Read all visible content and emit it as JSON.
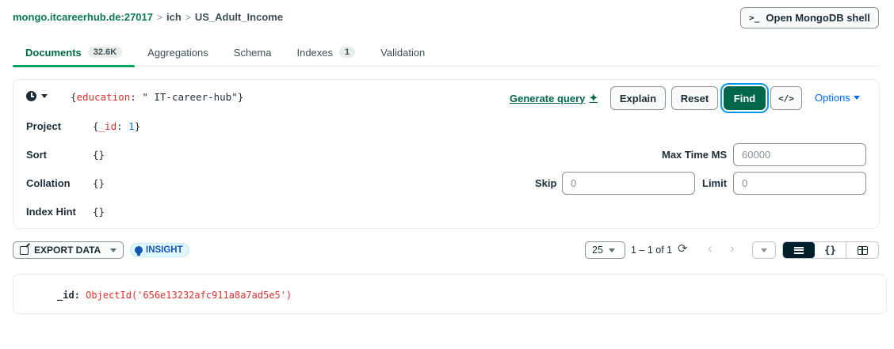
{
  "breadcrumb": {
    "host": "mongo.itcareerhub.de:27017",
    "database": "ich",
    "collection": "US_Adult_Income",
    "separator": ">"
  },
  "header": {
    "shell_button_prompt": ">_",
    "shell_button_label": "Open MongoDB shell"
  },
  "tabs": [
    {
      "label": "Documents",
      "badge": "32.6K",
      "active": true
    },
    {
      "label": "Aggregations"
    },
    {
      "label": "Schema"
    },
    {
      "label": "Indexes",
      "badge": "1"
    },
    {
      "label": "Validation"
    }
  ],
  "query": {
    "filter_prefix": "{",
    "filter_key": "education",
    "filter_colon": ": ",
    "filter_value": "\" IT-career-hub\"",
    "filter_suffix": "}",
    "generate_query_label": "Generate query",
    "sparkle_icon": "✦",
    "explain_label": "Explain",
    "reset_label": "Reset",
    "find_label": "Find",
    "code_label": "</>",
    "options_label": "Options",
    "project_label": "Project",
    "project_prefix": "{",
    "project_key": "_id",
    "project_colon": ": ",
    "project_value": "1",
    "project_suffix": "}",
    "sort_label": "Sort",
    "sort_value": "{}",
    "collation_label": "Collation",
    "collation_value": "{}",
    "index_hint_label": "Index Hint",
    "index_hint_value": "{}",
    "max_time_label": "Max Time MS",
    "max_time_placeholder": "60000",
    "skip_label": "Skip",
    "skip_placeholder": "0",
    "limit_label": "Limit",
    "limit_placeholder": "0"
  },
  "toolbar": {
    "export_label": "EXPORT DATA",
    "insight_label": "INSIGHT",
    "page_size": "25",
    "page_info": "1 – 1 of 1",
    "refresh_icon": "⟳",
    "prev_icon": "‹",
    "next_icon": "›",
    "json_view_label": "{}"
  },
  "documents": [
    {
      "key": "_id",
      "value": "ObjectId('656e13232afc911a8a7ad5e5')"
    }
  ],
  "colors": {
    "accent_green": "#00684a",
    "link_blue": "#016bf8",
    "key_red": "#db3030"
  }
}
